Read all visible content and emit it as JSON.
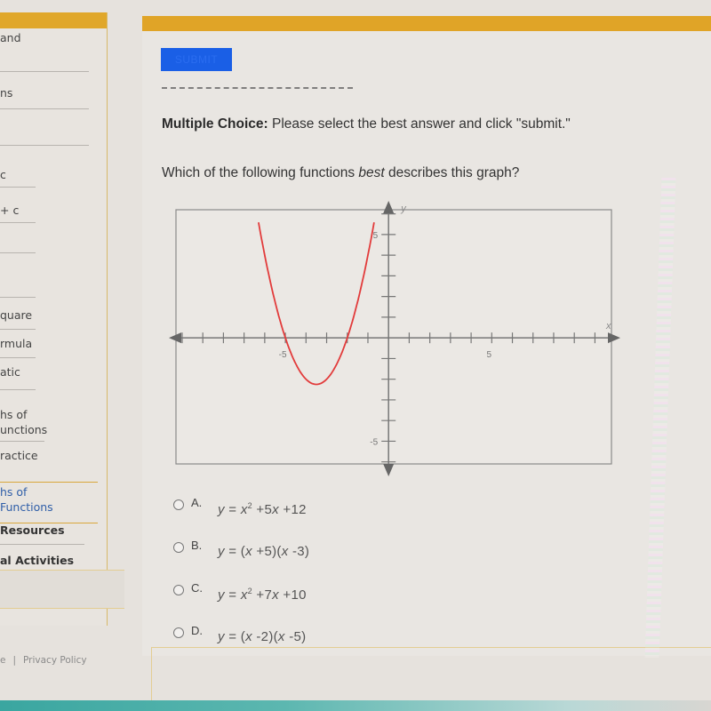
{
  "sidebar": {
    "items": [
      {
        "label": "and",
        "active": false
      },
      {
        "label": "ns",
        "active": false
      },
      {
        "label": "",
        "active": false
      },
      {
        "label": "c",
        "active": false
      },
      {
        "label": "+ c",
        "active": false
      },
      {
        "label": "",
        "active": false
      },
      {
        "label": "",
        "active": false
      },
      {
        "label": "quare",
        "active": false
      },
      {
        "label": "rmula",
        "active": false
      },
      {
        "label": "atic",
        "active": false
      },
      {
        "label": "hs of",
        "label2": "unctions",
        "active": false
      },
      {
        "label": "ractice",
        "active": false
      },
      {
        "label": "hs of",
        "label2": "Functions",
        "active": true
      },
      {
        "label": "Resources",
        "active": false
      },
      {
        "label": "al Activities",
        "active": false
      }
    ]
  },
  "footer": {
    "left_fragment": "e",
    "separator": "|",
    "privacy_policy": "Privacy Policy"
  },
  "main": {
    "submit_label": "SUBMIT",
    "instructions_bold": "Multiple Choice:",
    "instructions_text": " Please select the best answer and click \"submit.\"",
    "question_pre": "Which of the following functions ",
    "question_em": "best",
    "question_post": " describes this graph?",
    "answers": [
      {
        "letter": "A.",
        "formula_html": "y = x<sup>2</sup> +5x +12",
        "text": "y = x^2 + 5x + 12"
      },
      {
        "letter": "B.",
        "formula_html": "y = (x +5)(x -3)",
        "text": "y = (x + 5)(x - 3)"
      },
      {
        "letter": "C.",
        "formula_html": "y = x<sup>2</sup> +7x +10",
        "text": "y = x^2 + 7x + 10"
      },
      {
        "letter": "D.",
        "formula_html": "y = (x -2)(x -5)",
        "text": "y = (x - 2)(x - 5)"
      }
    ]
  },
  "colors": {
    "accent_bar": "#e0a427",
    "submit_button": "#1a5fe6",
    "curve": "#e23b3b",
    "axis": "#777777",
    "active_link": "#2f5ea8"
  },
  "chart_data": {
    "type": "line",
    "title": "",
    "xlabel": "x",
    "ylabel": "y",
    "xlim": [
      -10.3,
      10.8
    ],
    "ylim": [
      -6.1,
      6.2
    ],
    "x_ticks": [
      -10,
      -9,
      -8,
      -7,
      -6,
      -5,
      -4,
      -3,
      -2,
      -1,
      1,
      2,
      3,
      4,
      5,
      6,
      7,
      8,
      9,
      10
    ],
    "y_ticks": [
      -6,
      -5,
      -4,
      -3,
      -2,
      -1,
      1,
      2,
      3,
      4,
      5,
      6
    ],
    "x_tick_labels": [
      {
        "value": -5,
        "label": "-5"
      },
      {
        "value": 5,
        "label": "5"
      }
    ],
    "y_tick_labels": [
      {
        "value": 5,
        "label": "5"
      },
      {
        "value": -5,
        "label": "-5"
      }
    ],
    "grid": false,
    "series": [
      {
        "name": "parabola",
        "equation": "y = x^2 + 7x + 10",
        "roots": [
          -5,
          -2
        ],
        "vertex": [
          -3.5,
          -2.25
        ],
        "x": [
          -6.3,
          -6,
          -5.5,
          -5,
          -4.5,
          -4,
          -3.5,
          -3,
          -2.5,
          -2,
          -1.5,
          -1,
          -0.7
        ],
        "values": [
          6.19,
          4,
          1.75,
          0,
          -1.25,
          -2,
          -2.25,
          -2,
          -1.25,
          0,
          1.75,
          4,
          5.59
        ]
      }
    ]
  }
}
